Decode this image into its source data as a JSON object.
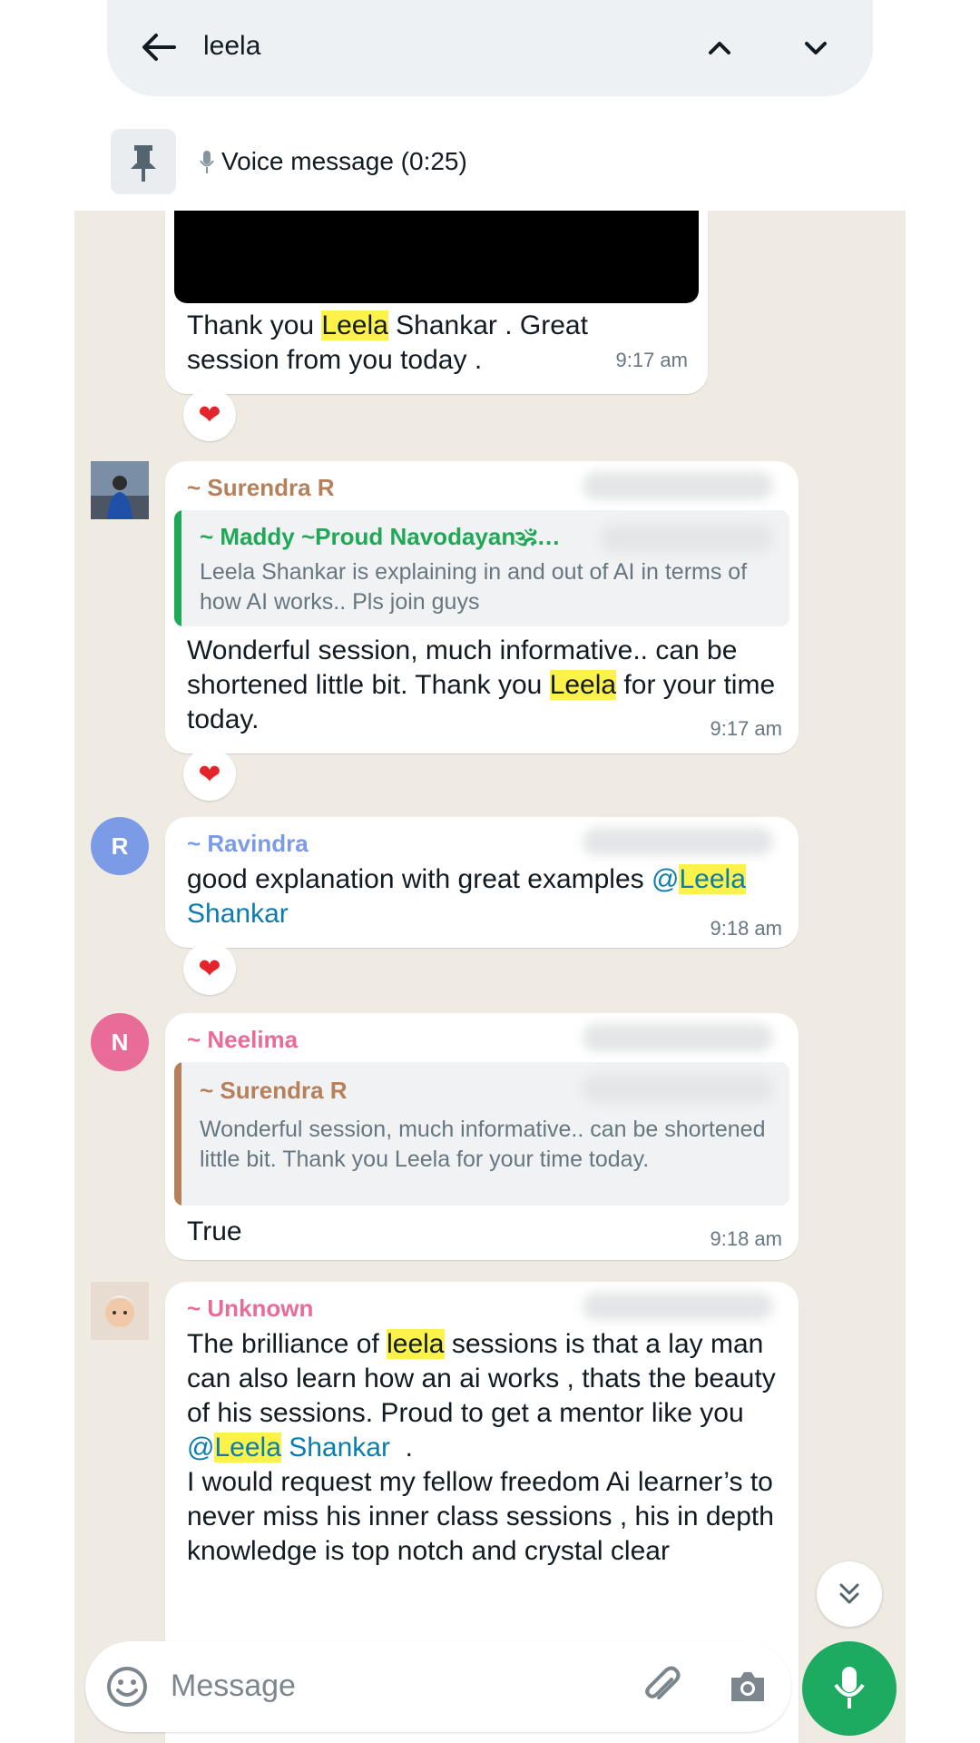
{
  "search": {
    "query": "leela"
  },
  "pinned": {
    "text": "Voice message (0:25)"
  },
  "messages": [
    {
      "text_parts": [
        "Thank you ",
        "Leela",
        " Shankar . Great session from you today ."
      ],
      "time": "9:17 am",
      "reaction": "❤"
    },
    {
      "sender": "~ Surendra R",
      "quote": {
        "sender": "~ Maddy ~Proud Navodayan🕉…",
        "text": "Leela Shankar is explaining in and out of AI in terms of how AI works.. Pls join guys"
      },
      "text_parts": [
        "Wonderful session, much informative.. can be shortened little bit. Thank you ",
        "Leela",
        " for your time today."
      ],
      "time": "9:17 am",
      "reaction": "❤"
    },
    {
      "sender": "~ Ravindra",
      "avatar_letter": "R",
      "text_parts": [
        "good explanation with great examples ",
        "@",
        "Leela",
        "Shankar"
      ],
      "time": "9:18 am",
      "reaction": "❤"
    },
    {
      "sender": "~ Neelima",
      "avatar_letter": "N",
      "quote": {
        "sender": "~ Surendra R",
        "text": "Wonderful session, much informative.. can be shortened little bit. Thank you Leela for your time today."
      },
      "text": "True",
      "time": "9:18 am"
    },
    {
      "sender": "~ Unknown",
      "text_parts": [
        "The brilliance of ",
        "leela",
        " sessions is that a lay man can also learn how an ai works , thats the beauty of his sessions. Proud to get a mentor like you ",
        "@",
        "Leela",
        " Shankar",
        "  .",
        "I would request my fellow freedom Ai learner’s to never miss his inner class sessions , his in depth knowledge is top notch and crystal clear"
      ]
    }
  ],
  "composer": {
    "placeholder": "Message"
  },
  "colors": {
    "accent": "#1daa61",
    "highlight": "#fcf24a",
    "mention": "#0a7cae",
    "surendra": "#b5805b",
    "maddy": "#1fa855",
    "ravindra": "#7c9be6",
    "neelima": "#e96b98",
    "unknown": "#e96b98"
  }
}
